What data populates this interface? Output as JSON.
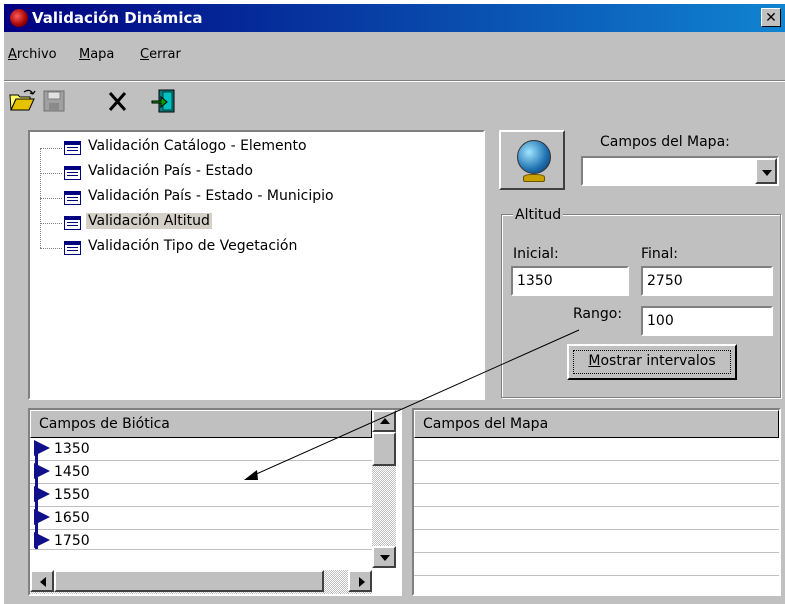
{
  "window": {
    "title": "Validación Dinámica",
    "close": "✕"
  },
  "menu": [
    {
      "label": "Archivo",
      "hotkey": "A",
      "rest": "rchivo"
    },
    {
      "label": "Mapa",
      "hotkey": "M",
      "rest": "apa"
    },
    {
      "label": "Cerrar",
      "hotkey": "C",
      "rest": "errar"
    }
  ],
  "toolbar": {
    "icons": [
      "open-folder-icon",
      "save-icon",
      "delete-icon",
      "exit-icon"
    ]
  },
  "tree": {
    "items": [
      "Validación Catálogo - Elemento",
      "Validación País - Estado",
      "Validación País - Estado - Municipio",
      "Validación Altitud",
      "Validación Tipo de Vegetación"
    ],
    "selected_index": 3
  },
  "map_fields": {
    "label": "Campos del Mapa:",
    "value": ""
  },
  "altitud": {
    "group_title": "Altitud",
    "inicial_label": "Inicial:",
    "final_label": "Final:",
    "inicial_value": "1350",
    "final_value": "2750",
    "rango_label": "Rango:",
    "rango_value": "100",
    "button": {
      "hotkey": "M",
      "rest": "ostrar intervalos"
    }
  },
  "biotica_list": {
    "header": "Campos de Biótica",
    "rows": [
      "1350",
      "1450",
      "1550",
      "1650",
      "1750"
    ]
  },
  "mapa_list": {
    "header": "Campos del Mapa"
  },
  "colors": {
    "face": "#c0c0c0",
    "title_start": "#000080",
    "title_end": "#1084d0",
    "flag": "#10108a"
  }
}
